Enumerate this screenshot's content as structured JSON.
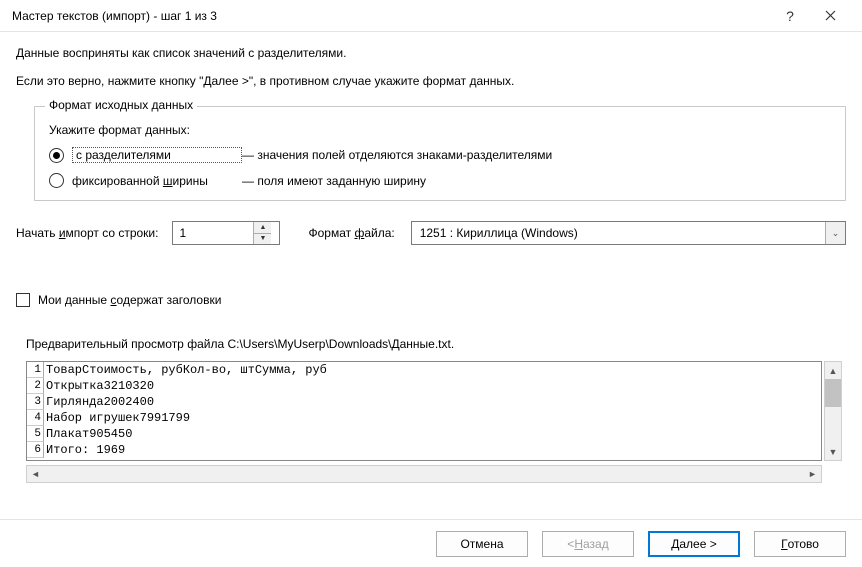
{
  "titlebar": {
    "title": "Мастер текстов (импорт) - шаг 1 из 3"
  },
  "intro": {
    "line1": "Данные восприняты как список значений с разделителями.",
    "line2": "Если это верно, нажмите кнопку \"Далее >\", в противном случае укажите формат данных."
  },
  "group": {
    "legend": "Формат исходных данных",
    "hint": "Укажите формат данных:",
    "opt1_label": "с разделителями",
    "opt1_desc": "— значения полей отделяются знаками-разделителями",
    "opt2_prefix": "фиксированной ",
    "opt2_u": "ш",
    "opt2_suffix": "ирины",
    "opt2_desc": "— поля имеют заданную ширину"
  },
  "row": {
    "start_prefix": "Начать ",
    "start_u": "и",
    "start_suffix": "мпорт со строки:",
    "start_value": "1",
    "format_prefix": "Формат ",
    "format_u": "ф",
    "format_suffix": "айла:",
    "encoding": "1251 : Кириллица (Windows)"
  },
  "checkbox": {
    "prefix": "Мои данные ",
    "u": "с",
    "suffix": "одержат заголовки"
  },
  "preview": {
    "label": "Предварительный просмотр файла C:\\Users\\MyUserp\\Downloads\\Данные.txt.",
    "lines": [
      {
        "n": "1",
        "t": "ТоварСтоимость, рубКол-во, штСумма, руб"
      },
      {
        "n": "2",
        "t": "Открытка3210320"
      },
      {
        "n": "3",
        "t": "Гирлянда2002400"
      },
      {
        "n": "4",
        "t": "Набор игрушек7991799"
      },
      {
        "n": "5",
        "t": "Плакат905450"
      },
      {
        "n": "6",
        "t": "Итого: 1969"
      }
    ]
  },
  "footer": {
    "cancel": "Отмена",
    "back_prefix": "< ",
    "back_u": "Н",
    "back_suffix": "азад",
    "next_u": "Д",
    "next_suffix": "алее >",
    "finish_u": "Г",
    "finish_suffix": "отово"
  }
}
